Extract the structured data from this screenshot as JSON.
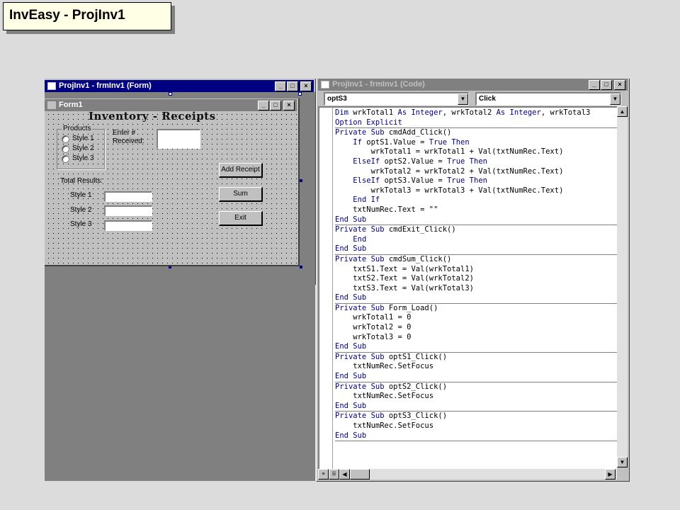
{
  "slide": {
    "title": "InvEasy - ProjInv1"
  },
  "designer": {
    "window_title": "ProjInv1 - frmInv1 (Form)",
    "form_title": "Form1",
    "heading": "Inventory - Receipts",
    "products_frame": "Products",
    "options": [
      "Style 1",
      "Style 2",
      "Style 3"
    ],
    "enter_label_1": "Enter #",
    "enter_label_2": "Received:",
    "total_results": "Total Results:",
    "result_labels": [
      "Style 1",
      "Style 2",
      "Style 3"
    ],
    "buttons": {
      "add": "Add Receipt",
      "sum": "Sum",
      "exit": "Exit"
    }
  },
  "code": {
    "window_title": "ProjInv1 - frmInv1 (Code)",
    "object_combo": "optS3",
    "proc_combo": "Click",
    "procedures": [
      {
        "lines": [
          [
            {
              "t": "Dim ",
              "k": 1
            },
            {
              "t": "wrkTotal1 "
            },
            {
              "t": "As Integer",
              "k": 1
            },
            {
              "t": ", wrkTotal2 "
            },
            {
              "t": "As Integer",
              "k": 1
            },
            {
              "t": ", wrkTotal3"
            }
          ],
          [
            {
              "t": "Option Explicit",
              "k": 1
            }
          ]
        ]
      },
      {
        "lines": [
          [
            {
              "t": "Private Sub ",
              "k": 1
            },
            {
              "t": "cmdAdd_Click()"
            }
          ],
          [
            {
              "t": "    "
            },
            {
              "t": "If ",
              "k": 1
            },
            {
              "t": "optS1.Value = "
            },
            {
              "t": "True Then",
              "k": 1
            }
          ],
          [
            {
              "t": "        wrkTotal1 = wrkTotal1 + Val(txtNumRec.Text)"
            }
          ],
          [
            {
              "t": "    "
            },
            {
              "t": "ElseIf ",
              "k": 1
            },
            {
              "t": "optS2.Value = "
            },
            {
              "t": "True Then",
              "k": 1
            }
          ],
          [
            {
              "t": "        wrkTotal2 = wrkTotal2 + Val(txtNumRec.Text)"
            }
          ],
          [
            {
              "t": "    "
            },
            {
              "t": "ElseIf ",
              "k": 1
            },
            {
              "t": "optS3.Value = "
            },
            {
              "t": "True Then",
              "k": 1
            }
          ],
          [
            {
              "t": "        wrkTotal3 = wrkTotal3 + Val(txtNumRec.Text)"
            }
          ],
          [
            {
              "t": "    "
            },
            {
              "t": "End If",
              "k": 1
            }
          ],
          [
            {
              "t": "    txtNumRec.Text = \"\""
            }
          ],
          [
            {
              "t": "End Sub",
              "k": 1
            }
          ]
        ]
      },
      {
        "lines": [
          [
            {
              "t": "Private Sub ",
              "k": 1
            },
            {
              "t": "cmdExit_Click()"
            }
          ],
          [
            {
              "t": "    "
            },
            {
              "t": "End",
              "k": 1
            }
          ],
          [
            {
              "t": "End Sub",
              "k": 1
            }
          ]
        ]
      },
      {
        "lines": [
          [
            {
              "t": "Private Sub ",
              "k": 1
            },
            {
              "t": "cmdSum_Click()"
            }
          ],
          [
            {
              "t": "    txtS1.Text = Val(wrkTotal1)"
            }
          ],
          [
            {
              "t": "    txtS2.Text = Val(wrkTotal2)"
            }
          ],
          [
            {
              "t": "    txtS3.Text = Val(wrkTotal3)"
            }
          ],
          [
            {
              "t": "End Sub",
              "k": 1
            }
          ]
        ]
      },
      {
        "lines": [
          [
            {
              "t": "Private Sub ",
              "k": 1
            },
            {
              "t": "Form_Load()"
            }
          ],
          [
            {
              "t": "    wrkTotal1 = 0"
            }
          ],
          [
            {
              "t": "    wrkTotal2 = 0"
            }
          ],
          [
            {
              "t": "    wrkTotal3 = 0"
            }
          ],
          [
            {
              "t": "End Sub",
              "k": 1
            }
          ]
        ]
      },
      {
        "lines": [
          [
            {
              "t": "Private Sub ",
              "k": 1
            },
            {
              "t": "optS1_Click()"
            }
          ],
          [
            {
              "t": "    txtNumRec.SetFocus"
            }
          ],
          [
            {
              "t": "End Sub",
              "k": 1
            }
          ]
        ]
      },
      {
        "lines": [
          [
            {
              "t": "Private Sub ",
              "k": 1
            },
            {
              "t": "optS2_Click()"
            }
          ],
          [
            {
              "t": "    txtNumRec.SetFocus"
            }
          ],
          [
            {
              "t": "End Sub",
              "k": 1
            }
          ]
        ]
      },
      {
        "lines": [
          [
            {
              "t": "Private Sub ",
              "k": 1
            },
            {
              "t": "optS3_Click()"
            }
          ],
          [
            {
              "t": "    txtNumRec.SetFocus"
            }
          ],
          [
            {
              "t": "End Sub",
              "k": 1
            }
          ]
        ]
      }
    ]
  },
  "colors": {
    "keyword": "#000080",
    "titlebar_active": "#000080",
    "titlebar_inactive": "#808080"
  },
  "icons": {
    "minimize": "_",
    "restore": "□",
    "close": "×",
    "dropdown": "▼",
    "up": "▲",
    "down": "▼",
    "left": "◀",
    "right": "▶"
  }
}
